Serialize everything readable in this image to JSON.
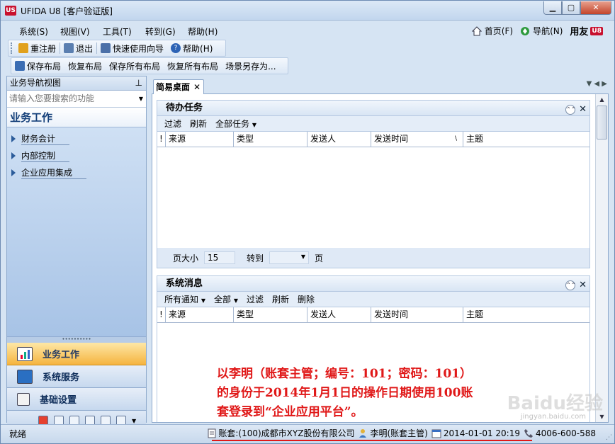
{
  "window": {
    "title": "UFIDA U8 [客户验证版]",
    "app_logo": "US",
    "min_glyph": "▁",
    "max_glyph": "▢",
    "close_glyph": "✕"
  },
  "menubar": {
    "items": [
      "系统(S)",
      "视图(V)",
      "工具(T)",
      "转到(G)",
      "帮助(H)"
    ],
    "home": "首页(F)",
    "navigate": "导航(N)",
    "brand": "用友",
    "brand_badge": "U8"
  },
  "toolbar1": {
    "relogin": "重注册",
    "exit": "退出",
    "wizard": "快速使用向导",
    "help": "帮助(H)"
  },
  "toolbar2": {
    "items": [
      "保存布局",
      "恢复布局",
      "保存所有布局",
      "恢复所有布局",
      "场景另存为..."
    ]
  },
  "nav": {
    "header": "业务导航视图",
    "search_placeholder": "请输入您要搜索的功能",
    "section_title": "业务工作",
    "tree": [
      "财务会计",
      "内部控制",
      "企业应用集成"
    ],
    "splitter": "••••••••••",
    "big_buttons": [
      "业务工作",
      "系统服务",
      "基础设置"
    ]
  },
  "tabs": {
    "active": "简易桌面",
    "close_glyph": "✕",
    "arrows": "▼ ◀ ▶"
  },
  "todo_panel": {
    "title": "待办任务",
    "tools": [
      "过滤",
      "刷新",
      "全部任务"
    ],
    "columns": [
      "!",
      "来源",
      "类型",
      "发送人",
      "发送时间",
      "主题"
    ],
    "page_size_label": "页大小",
    "page_size": "15",
    "goto_label": "转到",
    "page_label": "页"
  },
  "msg_panel": {
    "title": "系统消息",
    "tools": [
      "所有通知",
      "全部",
      "过滤",
      "刷新",
      "删除"
    ],
    "columns": [
      "!",
      "来源",
      "类型",
      "发送人",
      "发送时间",
      "主题"
    ]
  },
  "annotation": {
    "line1": "以李明（账套主管；编号：101；密码：101）",
    "line2": "的身份于2014年1月1日的操作日期使用100账",
    "line3": "套登录到“企业应用平台”。"
  },
  "watermark": {
    "text": "Baidu经验",
    "url": "jingyan.baidu.com"
  },
  "status": {
    "left": "就绪",
    "account": "账套:(100)成都市XYZ股份有限公司",
    "user": "李明(账套主管)",
    "date": "2014-01-01 20:19",
    "phone": "4006-600-588"
  },
  "colors": {
    "accent": "#e01818",
    "active_nav": "#f5b43f",
    "brand_red": "#c8102e"
  }
}
